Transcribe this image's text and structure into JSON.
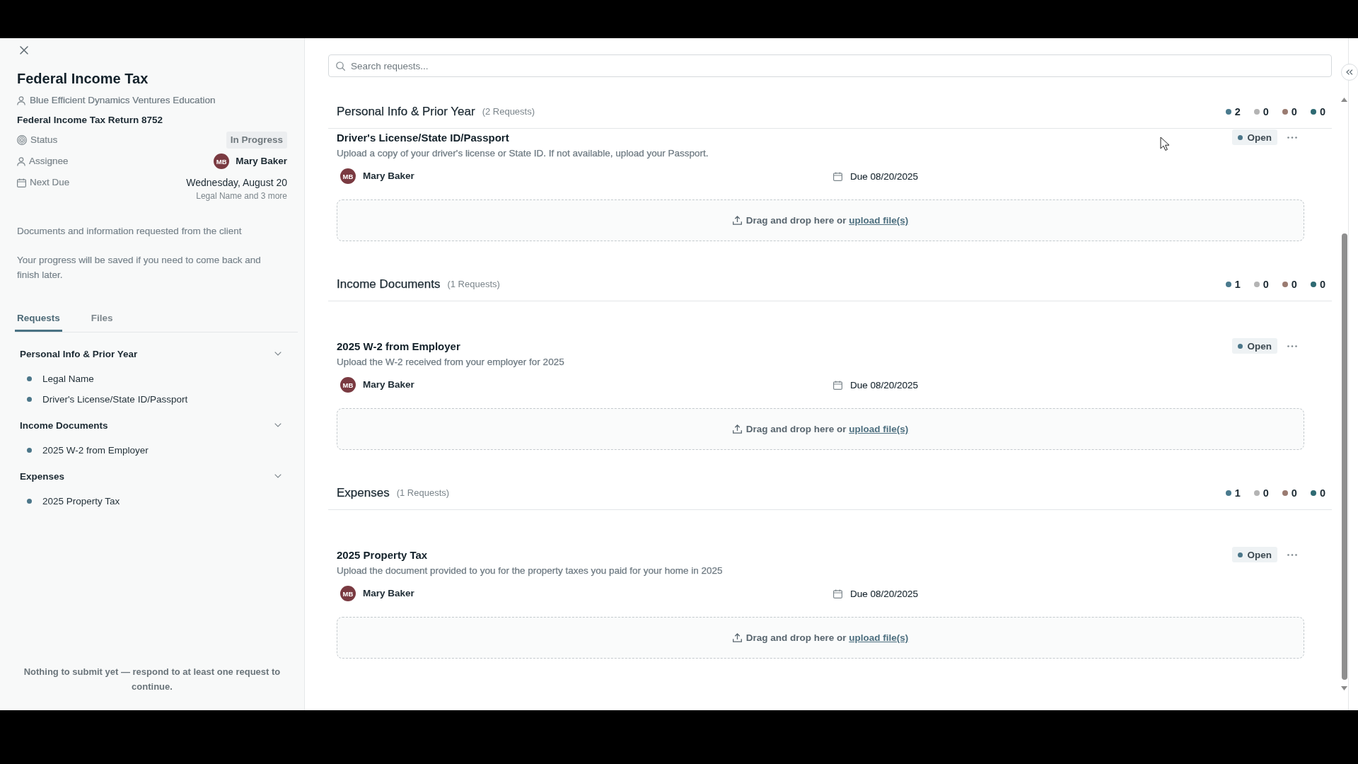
{
  "panel": {
    "title": "Federal Income Tax",
    "client": "Blue Efficient Dynamics Ventures Education",
    "engagement": "Federal Income Tax Return 8752",
    "details": [
      {
        "kind": "status",
        "label": "Status",
        "value": "In Progress"
      },
      {
        "kind": "assignee",
        "label": "Assignee",
        "initials": "MB",
        "value": "Mary Baker"
      },
      {
        "kind": "due",
        "label": "Next Due",
        "value": "Wednesday, August 20",
        "note": "Legal Name and 3 more"
      }
    ],
    "description": "Documents and information requested from the client",
    "hint": "Your progress will be saved if you need to come back and finish later.",
    "tabs": [
      {
        "label": "Requests",
        "selected": true
      },
      {
        "label": "Files",
        "selected": false
      }
    ],
    "outline": [
      {
        "label": "Personal Info & Prior Year",
        "expanded": true,
        "children": [
          {
            "label": "Legal Name"
          },
          {
            "label": "Driver's License/State ID/Passport"
          }
        ]
      },
      {
        "label": "Income Documents",
        "expanded": true,
        "children": [
          {
            "label": "2025 W-2 from Employer"
          }
        ]
      },
      {
        "label": "Expenses",
        "expanded": true,
        "children": [
          {
            "label": "2025 Property Tax"
          }
        ]
      }
    ],
    "footer": "Nothing to submit yet — respond to at least one request to continue."
  },
  "search": {
    "placeholder": "Search requests..."
  },
  "sections": [
    {
      "title": "Personal Info & Prior Year",
      "count": "(2 Requests)",
      "tallies": [
        {
          "value": "2",
          "color": "#4a7a8d"
        },
        {
          "value": "0",
          "color": "#b4b4b4"
        },
        {
          "value": "0",
          "color": "#9a7b71"
        },
        {
          "value": "0",
          "color": "#2e6a73"
        }
      ],
      "requests": [
        {
          "title": "Driver's License/State ID/Passport",
          "description": "Upload a copy of your driver's license or State ID. If not available, upload your Passport.",
          "status": "Open",
          "initials": "MB",
          "assignee": "Mary Baker",
          "due": "Due 08/20/2025",
          "upload_prompt": "Drag and drop here or",
          "upload_link": "upload file(s)"
        }
      ]
    },
    {
      "title": "Income Documents",
      "count": "(1 Requests)",
      "tallies": [
        {
          "value": "1",
          "color": "#4a7a8d"
        },
        {
          "value": "0",
          "color": "#b4b4b4"
        },
        {
          "value": "0",
          "color": "#9a7b71"
        },
        {
          "value": "0",
          "color": "#2e6a73"
        }
      ],
      "requests": [
        {
          "title": "2025 W-2 from Employer",
          "description": "Upload the W-2 received from your employer for 2025",
          "status": "Open",
          "initials": "MB",
          "assignee": "Mary Baker",
          "due": "Due 08/20/2025",
          "upload_prompt": "Drag and drop here or",
          "upload_link": "upload file(s)"
        }
      ]
    },
    {
      "title": "Expenses",
      "count": "(1 Requests)",
      "tallies": [
        {
          "value": "1",
          "color": "#4a7a8d"
        },
        {
          "value": "0",
          "color": "#b4b4b4"
        },
        {
          "value": "0",
          "color": "#9a7b71"
        },
        {
          "value": "0",
          "color": "#2e6a73"
        }
      ],
      "requests": [
        {
          "title": "2025 Property Tax",
          "description": "Upload the document provided to you for the property taxes you paid for your home in 2025",
          "status": "Open",
          "initials": "MB",
          "assignee": "Mary Baker",
          "due": "Due 08/20/2025",
          "upload_prompt": "Drag and drop here or",
          "upload_link": "upload file(s)"
        }
      ]
    }
  ]
}
